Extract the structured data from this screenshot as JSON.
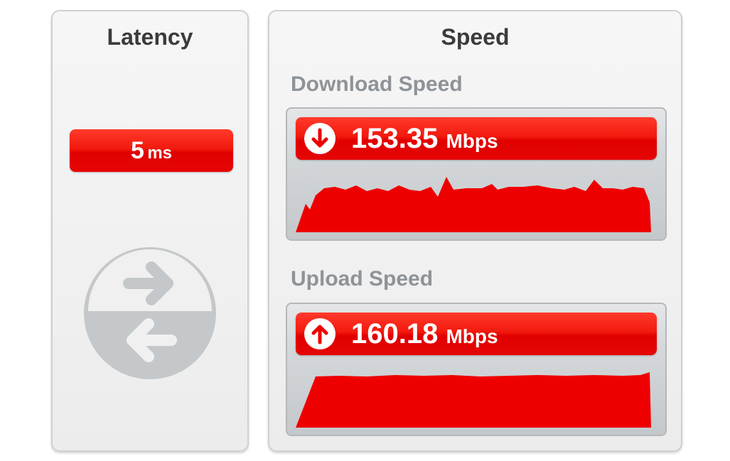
{
  "latency": {
    "title": "Latency",
    "value": "5",
    "unit": "ms",
    "icon": "bidirectional-arrows-icon"
  },
  "speed": {
    "title": "Speed",
    "download": {
      "title": "Download Speed",
      "value": "153.35",
      "unit": "Mbps",
      "icon": "arrow-down-circle-icon"
    },
    "upload": {
      "title": "Upload Speed",
      "value": "160.18",
      "unit": "Mbps",
      "icon": "arrow-up-circle-icon"
    }
  },
  "colors": {
    "accent_red": "#ee0000",
    "panel_border": "#cfd0d2",
    "title_text": "#3a3b3d",
    "section_text": "#8e9398",
    "icon_gray": "#c4c8ca"
  }
}
